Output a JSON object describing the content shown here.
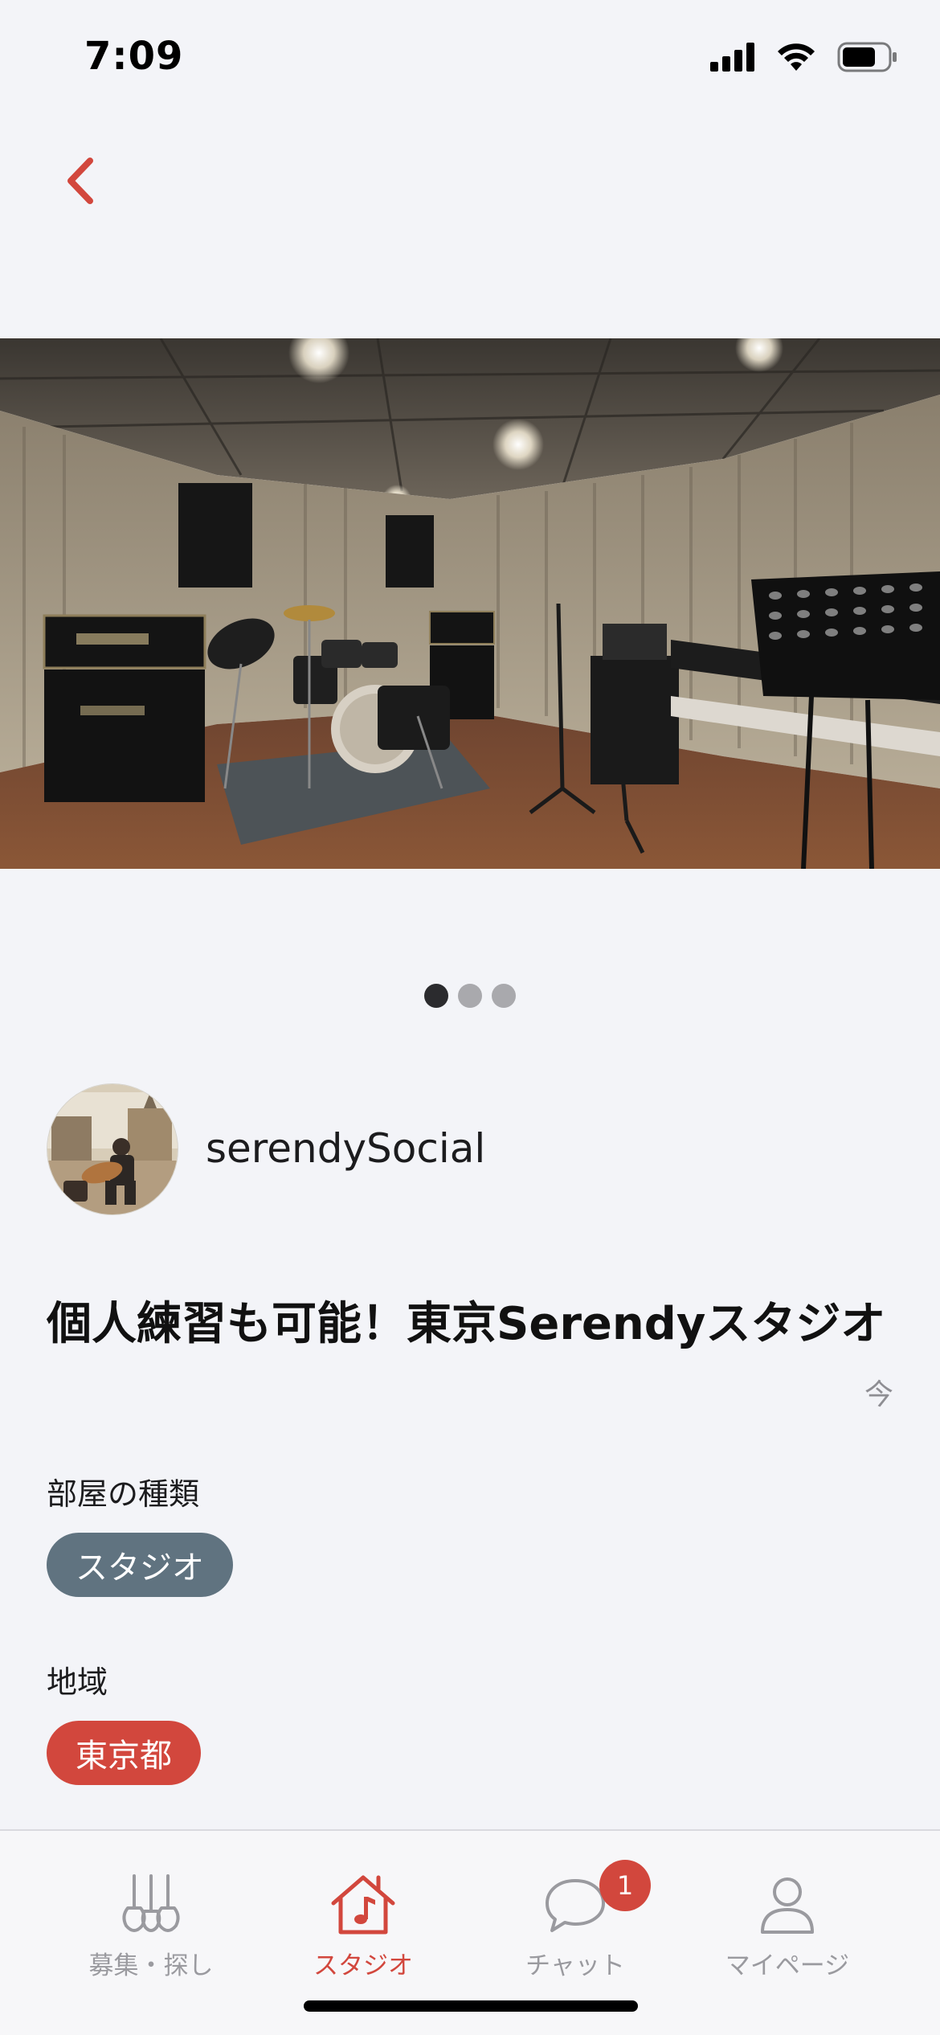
{
  "status_bar": {
    "time": "7:09"
  },
  "post": {
    "author": "serendySocial",
    "title": "個人練習も可能！東京Serendyスタジオ",
    "timestamp": "今"
  },
  "pager": {
    "count": 3,
    "active_index": 0
  },
  "room_type": {
    "label": "部屋の種類",
    "value": "スタジオ"
  },
  "region": {
    "label": "地域",
    "value": "東京都"
  },
  "tabbar": {
    "tabs": [
      {
        "label": "募集・探し",
        "icon": "guitars-icon"
      },
      {
        "label": "スタジオ",
        "icon": "studio-home-icon"
      },
      {
        "label": "チャット",
        "icon": "chat-bubble-icon",
        "badge": "1"
      },
      {
        "label": "マイページ",
        "icon": "person-icon"
      }
    ],
    "active_index": 1
  },
  "colors": {
    "accent": "#d2473d",
    "chip_gray": "#607380",
    "background": "#f3f4f8",
    "tab_inactive": "#9a9a9f"
  }
}
